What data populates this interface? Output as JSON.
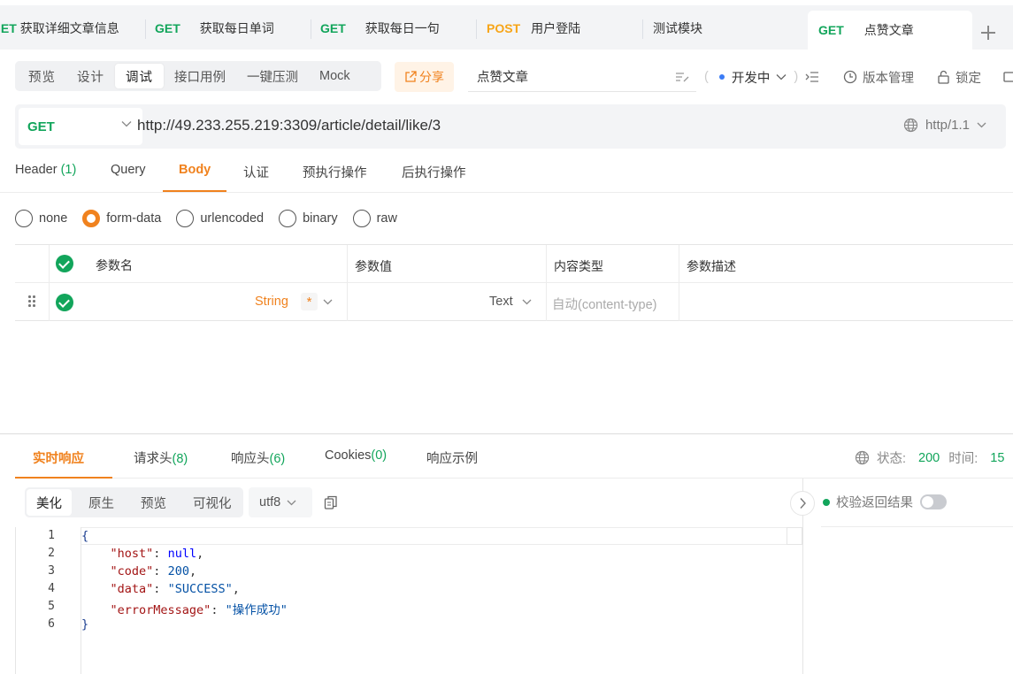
{
  "request_tabs": [
    {
      "method": "GET",
      "label": "获取详细文章信息"
    },
    {
      "method": "GET",
      "label": "获取每日单词"
    },
    {
      "method": "GET",
      "label": "获取每日一句"
    },
    {
      "method": "POST",
      "label": "用户登陆"
    },
    {
      "method": "",
      "label": "测试模块"
    },
    {
      "method": "GET",
      "label": "点赞文章"
    }
  ],
  "toolbar": {
    "modes": [
      "预览",
      "设计",
      "调试",
      "接口用例",
      "一键压测",
      "Mock"
    ],
    "active_mode": "调试",
    "share_label": "分享",
    "api_name": "点赞文章",
    "environment": "开发中",
    "version_label": "版本管理",
    "lock_label": "锁定"
  },
  "url_bar": {
    "method": "GET",
    "url": "http://49.233.255.219:3309/article/detail/like/3",
    "protocol": "http/1.1"
  },
  "param_tabs": [
    {
      "label": "Header",
      "count": "(1)"
    },
    {
      "label": "Query",
      "count": ""
    },
    {
      "label": "Body",
      "count": ""
    },
    {
      "label": "认证",
      "count": ""
    },
    {
      "label": "预执行操作",
      "count": ""
    },
    {
      "label": "后执行操作",
      "count": ""
    }
  ],
  "body_types": [
    "none",
    "form-data",
    "urlencoded",
    "binary",
    "raw"
  ],
  "selected_body_type": "form-data",
  "params_table": {
    "headers": [
      "参数名",
      "参数值",
      "内容类型",
      "参数描述"
    ],
    "rows": [
      {
        "type": "String",
        "required": "*",
        "value_type": "Text",
        "content_type_placeholder": "自动(content-type)"
      }
    ]
  },
  "response": {
    "tabs": [
      {
        "label": "实时响应",
        "count": ""
      },
      {
        "label": "请求头",
        "count": "(8)"
      },
      {
        "label": "响应头",
        "count": "(6)"
      },
      {
        "label": "Cookies",
        "count": "(0)"
      },
      {
        "label": "响应示例",
        "count": ""
      }
    ],
    "status_label": "状态:",
    "status_value": "200",
    "time_label": "时间:",
    "time_value": "15",
    "view_modes": [
      "美化",
      "原生",
      "预览",
      "可视化"
    ],
    "active_view": "美化",
    "encoding": "utf8",
    "validate_label": "校验返回结果",
    "line_numbers": [
      "1",
      "2",
      "3",
      "4",
      "5",
      "6"
    ],
    "body": {
      "host_key": "\"host\"",
      "host_val": "null",
      "code_key": "\"code\"",
      "code_val": "200",
      "data_key": "\"data\"",
      "data_val": "\"SUCCESS\"",
      "msg_key": "\"errorMessage\"",
      "msg_val": "\"操作成功\""
    }
  },
  "colors": {
    "accent": "#f0821e",
    "get": "#12a55b",
    "post": "#f7a518"
  }
}
